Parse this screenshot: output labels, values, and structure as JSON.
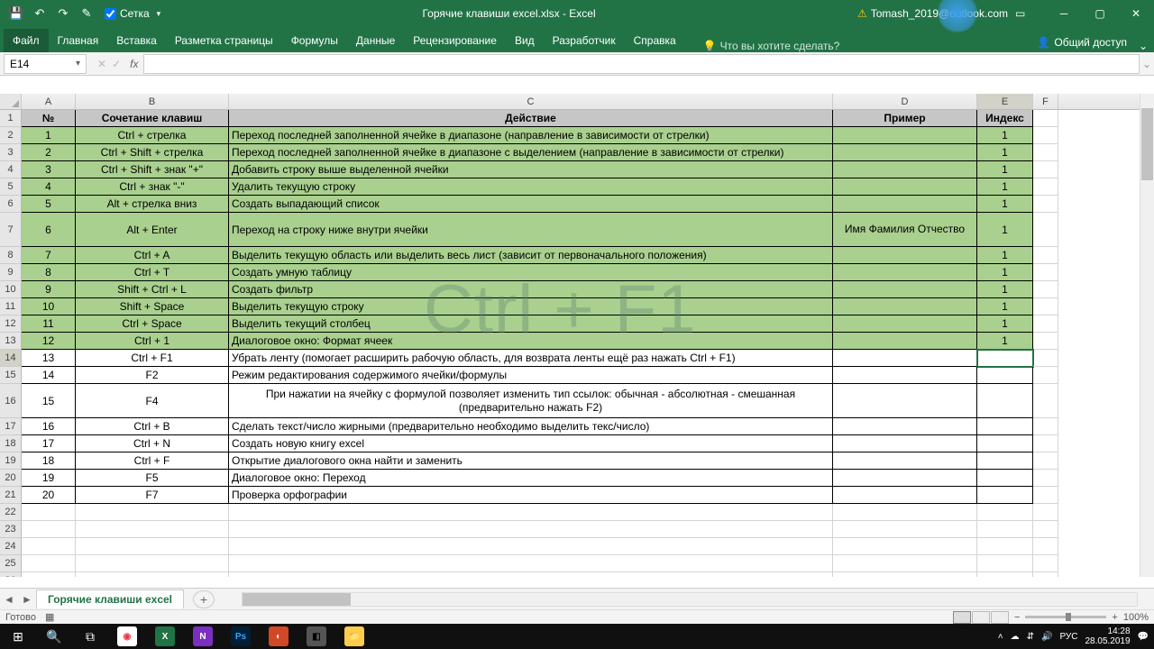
{
  "titlebar": {
    "grid_label": "Сетка",
    "title": "Горячие клавиши excel.xlsx - Excel",
    "user": "Tomash_2019@outlook.com"
  },
  "ribbon": {
    "file": "Файл",
    "tabs": [
      "Главная",
      "Вставка",
      "Разметка страницы",
      "Формулы",
      "Данные",
      "Рецензирование",
      "Вид",
      "Разработчик",
      "Справка"
    ],
    "tellme": "Что вы хотите сделать?",
    "share": "Общий доступ"
  },
  "formula": {
    "namebox": "E14"
  },
  "columns": {
    "widths": [
      60,
      170,
      670,
      160,
      62,
      28
    ],
    "labels": [
      "A",
      "B",
      "C",
      "D",
      "E",
      "F"
    ]
  },
  "headers": {
    "num": "№",
    "combo": "Сочетание клавиш",
    "action": "Действие",
    "example": "Пример",
    "index": "Индекс"
  },
  "rows": [
    {
      "n": "1",
      "c": "Ctrl + стрелка",
      "a": "Переход последней заполненной ячейке в диапазоне (направление в зависимости от стрелки)",
      "e": "",
      "i": "1",
      "g": true
    },
    {
      "n": "2",
      "c": "Ctrl + Shift + стрелка",
      "a": "Переход последней заполненной ячейке в диапазоне с выделением (направление в зависимости от стрелки)",
      "e": "",
      "i": "1",
      "g": true
    },
    {
      "n": "3",
      "c": "Ctrl + Shift + знак \"+\"",
      "a": "Добавить строку выше выделенной ячейки",
      "e": "",
      "i": "1",
      "g": true
    },
    {
      "n": "4",
      "c": "Ctrl + знак \"-\"",
      "a": "Удалить текущую строку",
      "e": "",
      "i": "1",
      "g": true
    },
    {
      "n": "5",
      "c": "Alt + стрелка вниз",
      "a": "Создать выпадающий список",
      "e": "",
      "i": "1",
      "g": true
    },
    {
      "n": "6",
      "c": "Alt + Enter",
      "a": "Переход на строку ниже внутри ячейки",
      "e": "Имя Фамилия\nОтчество",
      "i": "1",
      "g": true,
      "tall": true
    },
    {
      "n": "7",
      "c": "Ctrl + A",
      "a": "Выделить текущую область или выделить весь лист (зависит от первоначального положения)",
      "e": "",
      "i": "1",
      "g": true
    },
    {
      "n": "8",
      "c": "Ctrl + T",
      "a": "Создать умную таблицу",
      "e": "",
      "i": "1",
      "g": true
    },
    {
      "n": "9",
      "c": "Shift + Ctrl + L",
      "a": "Создать фильтр",
      "e": "",
      "i": "1",
      "g": true
    },
    {
      "n": "10",
      "c": "Shift + Space",
      "a": "Выделить текущую строку",
      "e": "",
      "i": "1",
      "g": true
    },
    {
      "n": "11",
      "c": "Ctrl + Space",
      "a": "Выделить текущий столбец",
      "e": "",
      "i": "1",
      "g": true
    },
    {
      "n": "12",
      "c": "Ctrl + 1",
      "a": "Диалоговое окно: Формат ячеек",
      "e": "",
      "i": "1",
      "g": true
    },
    {
      "n": "13",
      "c": "Ctrl + F1",
      "a": "Убрать ленту (помогает расширить рабочую область, для возврата ленты ещё раз нажать Ctrl + F1)",
      "e": "",
      "i": "",
      "g": false,
      "selrow": true
    },
    {
      "n": "14",
      "c": "F2",
      "a": "Режим редактирования содержимого ячейки/формулы",
      "e": "",
      "i": "",
      "g": false
    },
    {
      "n": "15",
      "c": "F4",
      "a": "При нажатии на ячейку с формулой позволяет изменить тип ссылок:\nобычная - абсолютная - смешанная (предварительно нажать F2)",
      "e": "",
      "i": "",
      "g": false,
      "tall": true
    },
    {
      "n": "16",
      "c": "Ctrl + B",
      "a": "Сделать текст/число жирными (предварительно необходимо выделить текс/число)",
      "e": "",
      "i": "",
      "g": false
    },
    {
      "n": "17",
      "c": "Ctrl + N",
      "a": "Создать новую книгу excel",
      "e": "",
      "i": "",
      "g": false
    },
    {
      "n": "18",
      "c": "Ctrl + F",
      "a": "Открытие диалогового окна найти и заменить",
      "e": "",
      "i": "",
      "g": false
    },
    {
      "n": "19",
      "c": "F5",
      "a": "Диалоговое окно: Переход",
      "e": "",
      "i": "",
      "g": false
    },
    {
      "n": "20",
      "c": "F7",
      "a": "Проверка орфографии",
      "e": "",
      "i": "",
      "g": false
    }
  ],
  "watermark": "Ctrl + F1",
  "sheet": {
    "name": "Горячие клавиши excel"
  },
  "status": {
    "ready": "Готово",
    "zoom": "100%"
  },
  "taskbar": {
    "lang": "РУС",
    "time": "14:28",
    "date": "28.05.2019"
  }
}
